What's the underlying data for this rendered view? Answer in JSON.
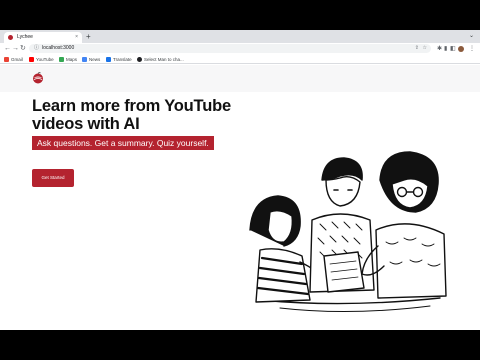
{
  "browser": {
    "tab": {
      "title": "Lychee",
      "close": "×"
    },
    "new_tab": "+",
    "tabstrip_menu": "⌄",
    "nav": {
      "back": "←",
      "forward": "→",
      "reload": "↻"
    },
    "address_bar": {
      "url": "localhost:3000",
      "lock": "ⓘ",
      "share": "⇪",
      "star": "☆"
    },
    "toolbar_icons": {
      "extensions": "✱",
      "pin": "▮",
      "sidebar": "◧",
      "menu": "⋮"
    },
    "bookmarks": [
      {
        "label": "Gmail",
        "color": "#ea4335"
      },
      {
        "label": "YouTube",
        "color": "#ff0000"
      },
      {
        "label": "Maps",
        "color": "#34a853"
      },
      {
        "label": "News",
        "color": "#4285f4"
      },
      {
        "label": "Translate",
        "color": "#1a73e8"
      },
      {
        "label": "Select Man to cha...",
        "color": "#202124"
      }
    ]
  },
  "page": {
    "hero": {
      "title": "Learn more from YouTube videos with AI",
      "tagline": "Ask questions. Get a summary. Quiz yourself.",
      "cta_label": "Get Started"
    },
    "colors": {
      "accent": "#b4232f",
      "header_bg": "#f7f7f8"
    }
  }
}
